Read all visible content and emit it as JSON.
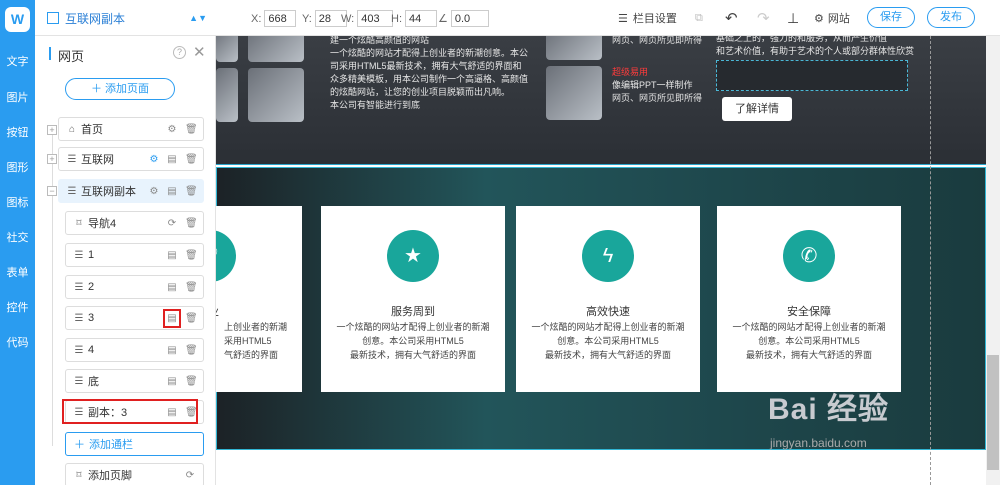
{
  "rail": {
    "logo": "W",
    "items": [
      "文字",
      "图片",
      "按钮",
      "图形",
      "图标",
      "社交",
      "表单",
      "控件",
      "代码"
    ]
  },
  "toolbar": {
    "page_name": "互联网副本",
    "x_label": "X:",
    "x_value": "668",
    "y_label": "Y:",
    "y_value": "28",
    "w_label": "W:",
    "w_value": "403",
    "h_label": "H:",
    "h_value": "44",
    "angle_icon": "angle-icon",
    "angle_value": "0.0",
    "column_settings": "栏目设置",
    "website": "网站",
    "save": "保存",
    "publish": "发布"
  },
  "panel": {
    "title": "网页",
    "add_page": "添加页面",
    "pages": [
      {
        "label": "首页",
        "icon": "home-icon"
      },
      {
        "label": "互联网",
        "icon": "list-icon"
      },
      {
        "label": "互联网副本",
        "icon": "list-icon"
      }
    ],
    "sections": [
      {
        "label": "导航4",
        "icon": "bookmark-icon"
      },
      {
        "label": "1",
        "icon": "list-icon"
      },
      {
        "label": "2",
        "icon": "list-icon"
      },
      {
        "label": "3",
        "icon": "list-icon"
      },
      {
        "label": "4",
        "icon": "list-icon"
      },
      {
        "label": "底",
        "icon": "list-icon"
      },
      {
        "label": "副本：3",
        "icon": "list-icon"
      }
    ],
    "add_nav": "添加通栏",
    "add_footer": "添加页脚"
  },
  "hero": {
    "left_lines": [
      "建一个炫酷高颜值的网站",
      "一个炫酷的网站才配得上创业者的新潮创意。本公",
      "司采用HTML5最新技术，拥有大气舒适的界面和",
      "众多精美模板，用本公司制作一个高逼格、高颜值",
      "的炫酷网站，让您的创业项目脱颖而出凡响。",
      "本公司有智能进行到底"
    ],
    "mid_top": "网页、网页所见即所得",
    "mid_red": "超级易用",
    "mid_lines": [
      "像编辑PPT一样制作",
      "网页、网页所见即所得"
    ],
    "right_lines": [
      "基础之上的，强力的和服务，从而产生价值",
      "和艺术价值，有助于艺术的个人或部分群体性欣赏"
    ],
    "learn_more": "了解详情"
  },
  "cards": [
    {
      "title": "业",
      "icon": "heart-icon",
      "lines": [
        "上创业者的新潮",
        "采用HTML5",
        "气舒适的界面"
      ]
    },
    {
      "title": "服务周到",
      "icon": "star-icon",
      "lines": [
        "一个炫酷的网站才配得上创业者的新潮",
        "创意。本公司采用HTML5",
        "最新技术，拥有大气舒适的界面"
      ]
    },
    {
      "title": "高效快速",
      "icon": "bolt-icon",
      "lines": [
        "一个炫酷的网站才配得上创业者的新潮",
        "创意。本公司采用HTML5",
        "最新技术，拥有大气舒适的界面"
      ]
    },
    {
      "title": "安全保障",
      "icon": "phone-icon",
      "lines": [
        "一个炫酷的网站才配得上创业者的新潮",
        "创意。本公司采用HTML5",
        "最新技术，拥有大气舒适的界面"
      ]
    }
  ],
  "watermark": {
    "brand": "Bai 经验",
    "url": "jingyan.baidu.com"
  },
  "colors": {
    "brand_blue": "#2a9cf0",
    "teal": "#19a69b",
    "highlight_red": "#e02020"
  }
}
